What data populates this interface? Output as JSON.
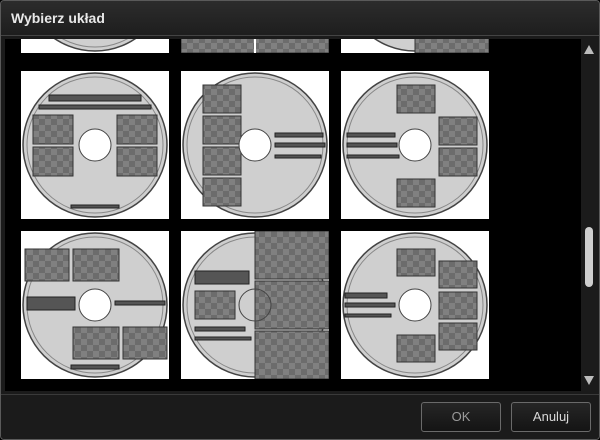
{
  "dialog": {
    "title": "Wybierz układ"
  },
  "buttons": {
    "ok": "OK",
    "cancel": "Anuluj"
  },
  "layouts": [
    "layout-partial-1",
    "layout-partial-2",
    "layout-partial-3",
    "layout-1",
    "layout-2",
    "layout-3",
    "layout-4",
    "layout-5",
    "layout-6"
  ]
}
